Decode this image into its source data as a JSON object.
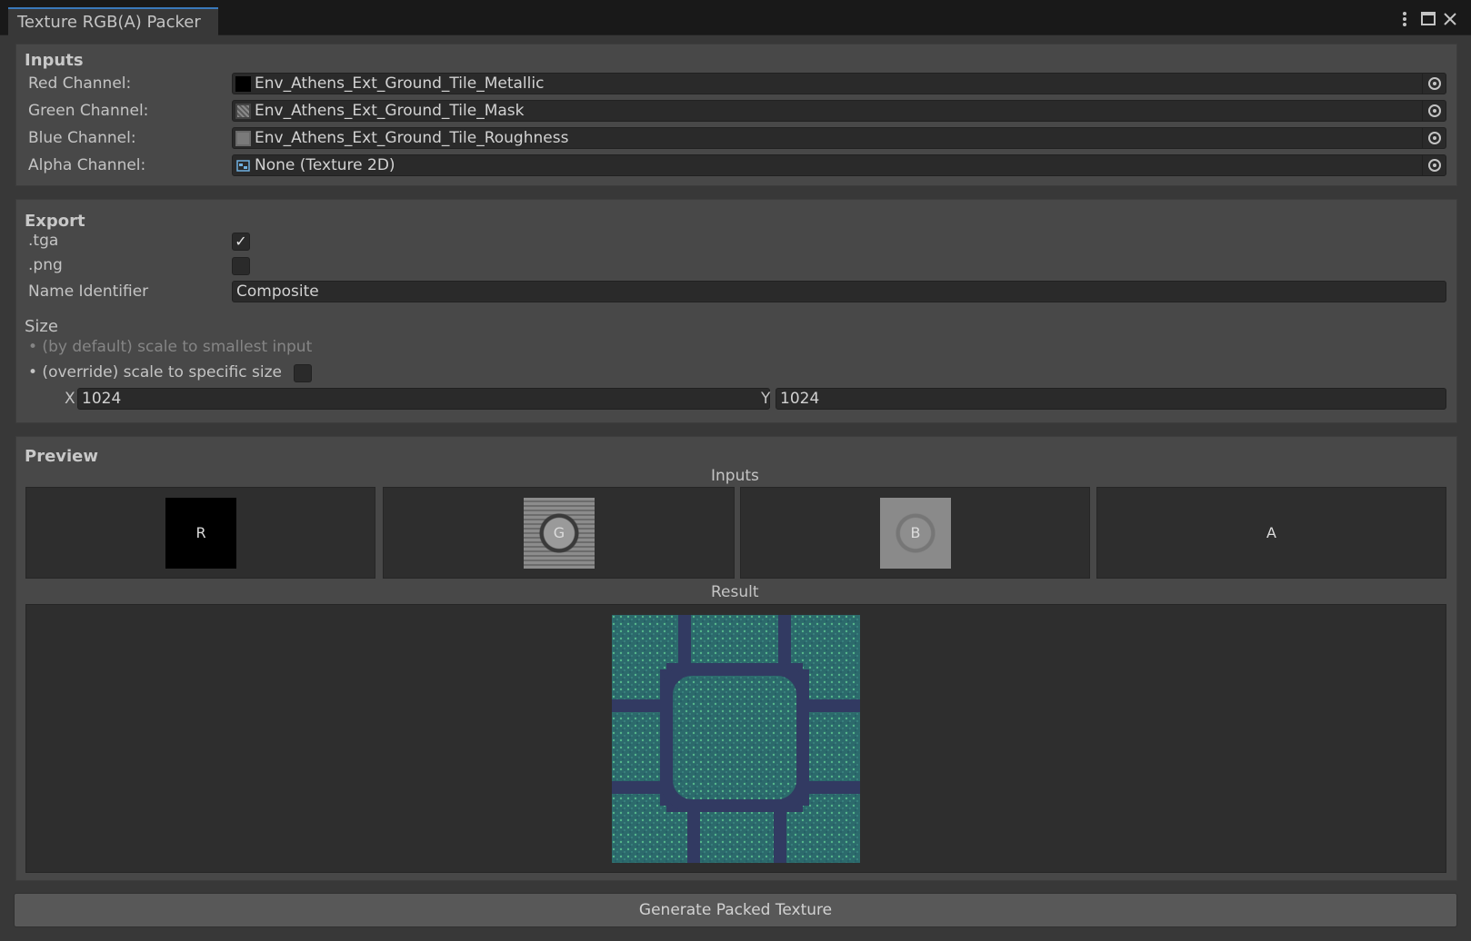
{
  "window": {
    "tab_title": "Texture RGB(A) Packer",
    "more_icon": "kebab-menu-icon",
    "maximize_icon": "maximize-icon",
    "close_icon": "close-icon"
  },
  "inputs": {
    "title": "Inputs",
    "channels": [
      {
        "label": "Red Channel:",
        "value": "Env_Athens_Ext_Ground_Tile_Metallic",
        "thumb": "black-texture-thumb"
      },
      {
        "label": "Green Channel:",
        "value": "Env_Athens_Ext_Ground_Tile_Mask",
        "thumb": "tile-texture-thumb"
      },
      {
        "label": "Blue Channel:",
        "value": "Env_Athens_Ext_Ground_Tile_Roughness",
        "thumb": "gray-texture-thumb"
      },
      {
        "label": "Alpha Channel:",
        "value": "None (Texture 2D)",
        "thumb": "texture2d-icon"
      }
    ]
  },
  "export": {
    "title": "Export",
    "tga_label": ".tga",
    "tga_checked": true,
    "tga_check_glyph": "✓",
    "png_label": ".png",
    "png_checked": false,
    "name_label": "Name Identifier",
    "name_value": "Composite",
    "size_title": "Size",
    "size_default": "• (by default) scale to smallest input",
    "size_override": "• (override) scale to specific size",
    "override_checked": false,
    "x_label": "X",
    "x_value": "1024",
    "y_label": "Y",
    "y_value": "1024"
  },
  "preview": {
    "title": "Preview",
    "inputs_label": "Inputs",
    "channel_letters": [
      "R",
      "G",
      "B",
      "A"
    ],
    "result_label": "Result"
  },
  "generate_label": "Generate Packed Texture",
  "colors": {
    "tab_accent": "#3a79bb",
    "panel": "#484848",
    "field": "#2a2a2a",
    "result_teal": "#2e6e6e"
  }
}
